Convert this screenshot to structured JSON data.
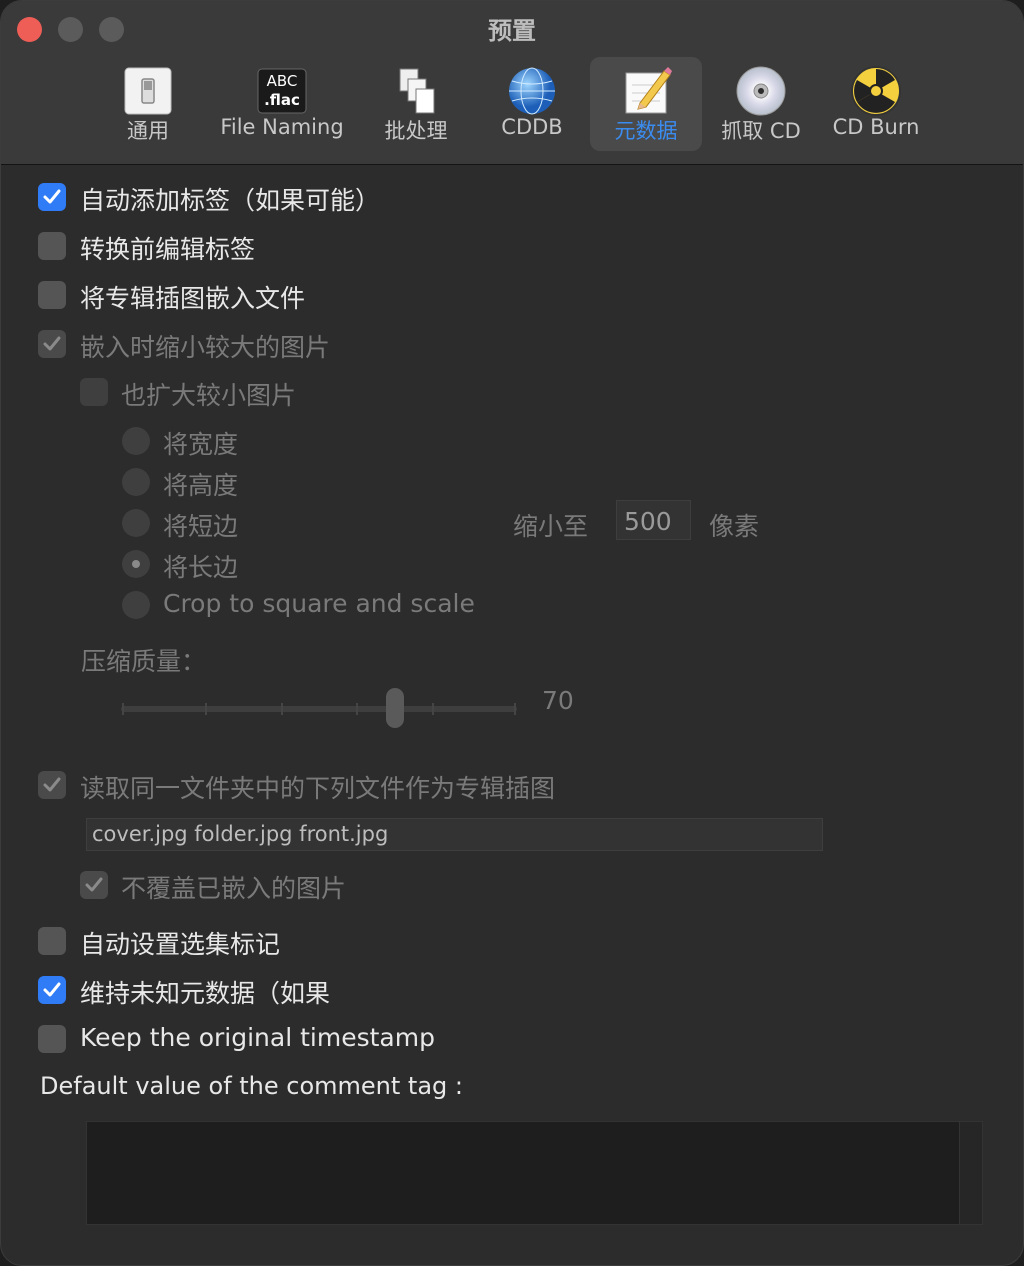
{
  "window": {
    "title": "预置"
  },
  "toolbar": {
    "items": [
      {
        "label": "通用",
        "icon": "switch-icon"
      },
      {
        "label": "File Naming",
        "icon": "abc-flac-icon"
      },
      {
        "label": "批处理",
        "icon": "documents-icon"
      },
      {
        "label": "CDDB",
        "icon": "globe-icon"
      },
      {
        "label": "元数据",
        "icon": "pencil-note-icon",
        "selected": true
      },
      {
        "label": "抓取 CD",
        "icon": "cd-icon"
      },
      {
        "label": "CD Burn",
        "icon": "radiation-icon"
      }
    ]
  },
  "options": {
    "auto_tag": "自动添加标签（如果可能）",
    "edit_before": "转换前编辑标签",
    "embed_art": "将专辑插图嵌入文件",
    "shrink_large": "嵌入时缩小较大的图片",
    "enlarge_small": "也扩大较小图片",
    "radio_width": "将宽度",
    "radio_height": "将高度",
    "radio_short": "将短边",
    "radio_long": "将长边",
    "radio_crop": "Crop to square and scale",
    "shrink_to": "缩小至",
    "shrink_value": "500",
    "pixels": "像素",
    "quality_label": "压缩质量：",
    "quality_value": "70",
    "read_files": "读取同一文件夹中的下列文件作为专辑插图",
    "file_list": "cover.jpg folder.jpg front.jpg",
    "no_overwrite": "不覆盖已嵌入的图片",
    "auto_compilation": "自动设置选集标记",
    "keep_unknown": "维持未知元数据（如果",
    "keep_timestamp": "Keep the original timestamp",
    "comment_label": "Default value of the comment tag :"
  },
  "state": {
    "auto_tag": true,
    "edit_before": false,
    "embed_art": false,
    "shrink_large": true,
    "enlarge_small": false,
    "radio_selected": "radio_long",
    "read_files": true,
    "no_overwrite": true,
    "auto_compilation": false,
    "keep_unknown": true,
    "keep_timestamp": false,
    "quality": 70
  },
  "colors": {
    "accent": "#2f7cf6",
    "close": "#ee5e57"
  }
}
